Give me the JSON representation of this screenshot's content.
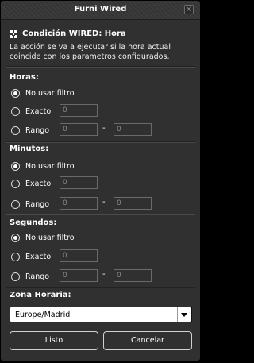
{
  "window": {
    "title": "Furni Wired"
  },
  "header": {
    "icon": "wired-icon",
    "title": "Condición WIRED: Hora",
    "description": "La acción se va a ejecutar si la hora actual coincide con los parametros configurados."
  },
  "sections": [
    {
      "label": "Horas:",
      "options": {
        "no_filter": "No usar filtro",
        "exact": "Exacto",
        "range": "Rango"
      },
      "selected": "no_filter",
      "exact_value": "0",
      "range_from": "0",
      "range_to": "0",
      "dash": "-"
    },
    {
      "label": "Minutos:",
      "options": {
        "no_filter": "No usar filtro",
        "exact": "Exacto",
        "range": "Rango"
      },
      "selected": "no_filter",
      "exact_value": "0",
      "range_from": "0",
      "range_to": "0",
      "dash": "-"
    },
    {
      "label": "Segundos:",
      "options": {
        "no_filter": "No usar filtro",
        "exact": "Exacto",
        "range": "Rango"
      },
      "selected": "no_filter",
      "exact_value": "0",
      "range_from": "0",
      "range_to": "0",
      "dash": "-"
    }
  ],
  "timezone": {
    "label": "Zona Horaria:",
    "selected": "Europe/Madrid"
  },
  "buttons": {
    "ok": "Listo",
    "cancel": "Cancelar"
  },
  "colors": {
    "window_bg": "#303030",
    "border": "#000000",
    "text": "#ffffff",
    "field_text": "#8a8a8a"
  }
}
